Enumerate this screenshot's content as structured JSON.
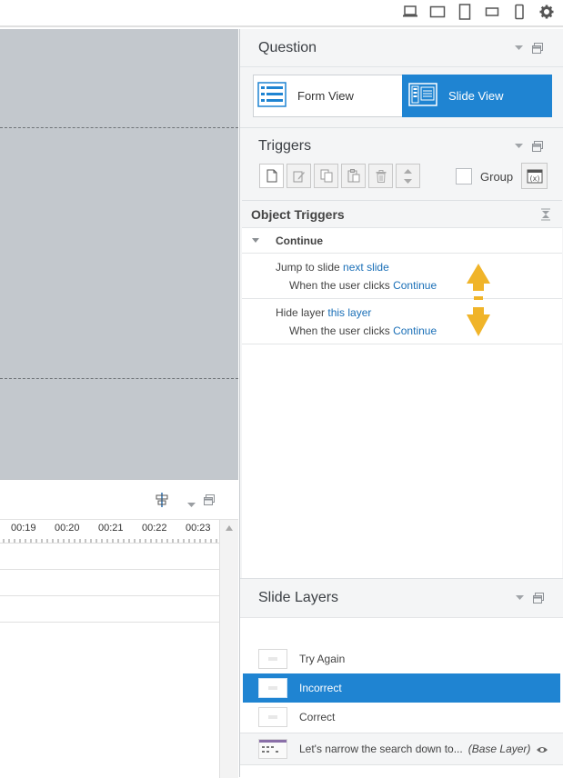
{
  "colors": {
    "accent": "#1f84d2",
    "link": "#1a6fb7",
    "canvas": "#c3c8cd",
    "arrow": "#f0b429"
  },
  "top_toolbar": {
    "icons": [
      "laptop-icon",
      "tablet-landscape-icon",
      "tablet-portrait-icon",
      "phone-landscape-icon",
      "phone-portrait-icon",
      "gear-icon"
    ]
  },
  "timeline": {
    "ticks": [
      "00:19",
      "00:20",
      "00:21",
      "00:22",
      "00:23"
    ]
  },
  "question": {
    "title": "Question",
    "form_view_label": "Form View",
    "slide_view_label": "Slide View"
  },
  "triggers": {
    "title": "Triggers",
    "group_label": "Group",
    "object_triggers_title": "Object Triggers",
    "object_name": "Continue",
    "items": [
      {
        "action": "Jump to slide",
        "target": "next slide",
        "when": "When the",
        "who": "user",
        "event": "clicks",
        "object": "Continue"
      },
      {
        "action": "Hide layer",
        "target": "this layer",
        "when": "When the",
        "who": "user",
        "event": "clicks",
        "object": "Continue"
      }
    ]
  },
  "slide_layers": {
    "title": "Slide Layers",
    "layers": [
      {
        "name": "Try Again",
        "selected": false
      },
      {
        "name": "Incorrect",
        "selected": true
      },
      {
        "name": "Correct",
        "selected": false
      }
    ],
    "base_layer": {
      "name": "Let's narrow the search down to...",
      "tag": "(Base Layer)"
    }
  }
}
